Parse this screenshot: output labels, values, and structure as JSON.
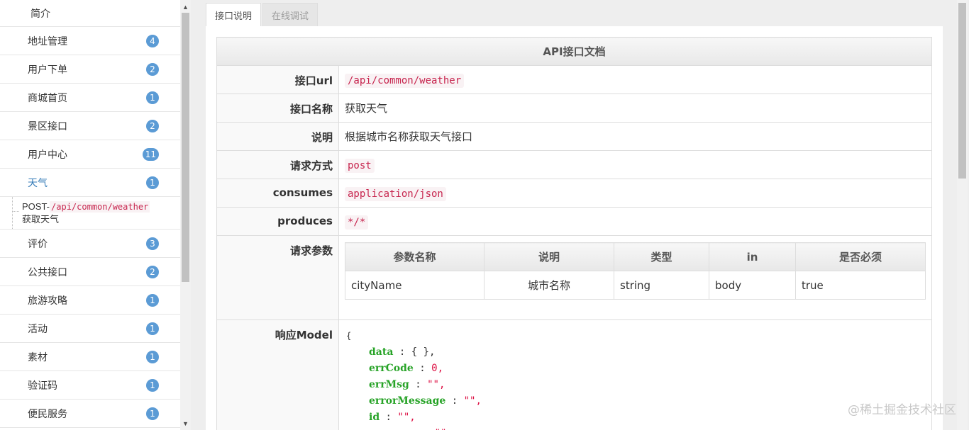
{
  "sidebar": {
    "top": {
      "label": "简介"
    },
    "items": [
      {
        "label": "地址管理",
        "count": "4"
      },
      {
        "label": "用户下单",
        "count": "2"
      },
      {
        "label": "商城首页",
        "count": "1"
      },
      {
        "label": "景区接口",
        "count": "2"
      },
      {
        "label": "用户中心",
        "count": "11"
      },
      {
        "label": "天气",
        "count": "1"
      },
      {
        "label": "评价",
        "count": "3"
      },
      {
        "label": "公共接口",
        "count": "2"
      },
      {
        "label": "旅游攻略",
        "count": "1"
      },
      {
        "label": "活动",
        "count": "1"
      },
      {
        "label": "素材",
        "count": "1"
      },
      {
        "label": "验证码",
        "count": "1"
      },
      {
        "label": "便民服务",
        "count": "1"
      }
    ],
    "sub_item": {
      "method": "POST-",
      "path": "/api/common/weather",
      "name": "获取天气"
    }
  },
  "tabs": [
    {
      "label": "接口说明"
    },
    {
      "label": "在线调试"
    }
  ],
  "doc": {
    "title": "API接口文档",
    "rows": {
      "url": {
        "key": "接口url",
        "value": "/api/common/weather"
      },
      "name": {
        "key": "接口名称",
        "value": "获取天气"
      },
      "desc": {
        "key": "说明",
        "value": "根据城市名称获取天气接口"
      },
      "method": {
        "key": "请求方式",
        "value": "post"
      },
      "consumes": {
        "key": "consumes",
        "value": "application/json"
      },
      "produces": {
        "key": "produces",
        "value": "*/*"
      },
      "params": {
        "key": "请求参数"
      },
      "model": {
        "key": "响应Model"
      }
    },
    "params_table": {
      "headers": [
        "参数名称",
        "说明",
        "类型",
        "in",
        "是否必须"
      ],
      "rows": [
        [
          "cityName",
          "城市名称",
          "string",
          "body",
          "true"
        ]
      ]
    },
    "model": {
      "open": "{",
      "lines": [
        {
          "key": "data",
          "sep": " : ",
          "value": "{ },"
        },
        {
          "key": "errCode",
          "sep": " : ",
          "value": "0,"
        },
        {
          "key": "errMsg",
          "sep": " : ",
          "value": "\"\","
        },
        {
          "key": "errorMessage",
          "sep": " : ",
          "value": "\"\","
        },
        {
          "key": "id",
          "sep": " : ",
          "value": "\"\","
        },
        {
          "key": "message",
          "sep": " : ",
          "value": "\"\""
        }
      ]
    }
  },
  "watermark": "@稀土掘金技术社区",
  "colors": {
    "badge": "#5b9bd5",
    "active_link": "#337ab7",
    "code_red": "#c7254e",
    "json_key": "#27a327"
  }
}
